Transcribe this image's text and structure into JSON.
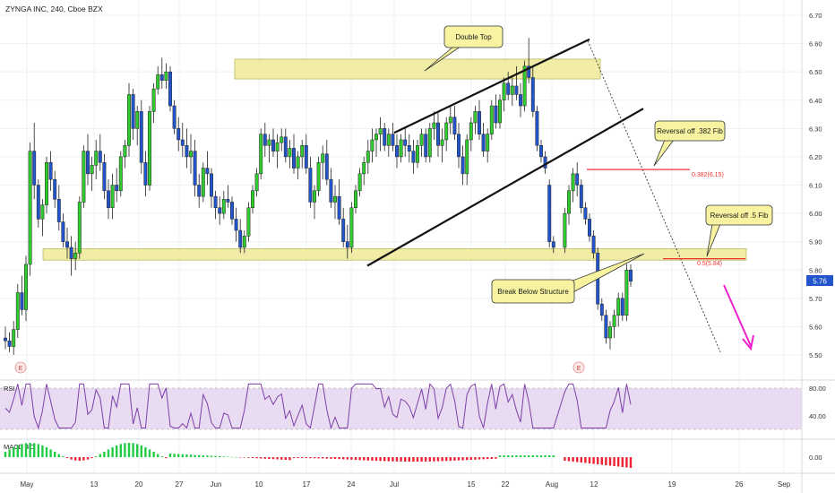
{
  "header": {
    "title": "ZYNGA INC, 240, Cboe BZX"
  },
  "colors": {
    "up": "#2ecc2e",
    "down": "#2255cc",
    "zone": "#f0ec9e",
    "zone_border": "#b7b14a",
    "fib_line": "#ee3333",
    "arrow": "#ee22cc",
    "rsi_line": "#7e3fa8",
    "rsi_band": "#e6d7f1",
    "macd_up": "#22cc44",
    "macd_down": "#ee2233",
    "price_badge": "#2255cc"
  },
  "price_axis": {
    "ticks": [
      "6.70",
      "6.60",
      "6.50",
      "6.40",
      "6.30",
      "6.20",
      "6.10",
      "6.00",
      "5.90",
      "5.80",
      "5.70",
      "5.60",
      "5.50"
    ]
  },
  "last_price": "5.76",
  "rsi": {
    "label": "RSI",
    "ticks": [
      "80.00",
      "40.00"
    ]
  },
  "macd": {
    "label": "MACD 4C",
    "ticks": [
      "0.00"
    ]
  },
  "time_axis": {
    "ticks": [
      "May",
      "13",
      "20",
      "27",
      "Jun",
      "10",
      "17",
      "24",
      "Jul",
      "15",
      "22",
      "Aug",
      "12",
      "19",
      "26",
      "Sep"
    ]
  },
  "annotations": {
    "double_top": "Double Top",
    "reversal_382": "Reversal off .382 Fib",
    "reversal_5": "Reversal off .5 Fib",
    "break_below": "Break Below Structure",
    "fib_382": "0.382(6.15)",
    "fib_5": "0.5(5.84)",
    "earnings_1": "E",
    "earnings_2": "E"
  },
  "chart_data": {
    "type": "candlestick",
    "title": "ZYNGA INC, 240, Cboe BZX",
    "y_range": [
      5.45,
      6.73
    ],
    "candles": [
      [
        "May 1",
        5.56,
        5.6,
        5.52,
        5.55
      ],
      [
        "May 1",
        5.55,
        5.58,
        5.51,
        5.53
      ],
      [
        "May 2",
        5.53,
        5.62,
        5.5,
        5.59
      ],
      [
        "May 2",
        5.59,
        5.75,
        5.56,
        5.72
      ],
      [
        "May 3",
        5.72,
        5.78,
        5.64,
        5.66
      ],
      [
        "May 3",
        5.66,
        5.85,
        5.62,
        5.82
      ],
      [
        "May 6",
        5.82,
        6.25,
        5.78,
        6.22
      ],
      [
        "May 6",
        6.22,
        6.32,
        6.05,
        6.1
      ],
      [
        "May 7",
        6.1,
        6.12,
        5.95,
        5.98
      ],
      [
        "May 7",
        5.98,
        6.05,
        5.92,
        6.03
      ],
      [
        "May 8",
        6.03,
        6.2,
        6.0,
        6.18
      ],
      [
        "May 8",
        6.18,
        6.22,
        6.08,
        6.12
      ],
      [
        "May 9",
        6.12,
        6.15,
        6.02,
        6.05
      ],
      [
        "May 9",
        6.05,
        6.1,
        5.94,
        5.97
      ],
      [
        "May 10",
        5.97,
        6.0,
        5.88,
        5.9
      ],
      [
        "May 10",
        5.9,
        5.95,
        5.84,
        5.88
      ],
      [
        "May 13",
        5.88,
        5.92,
        5.78,
        5.84
      ],
      [
        "May 13",
        5.84,
        5.9,
        5.8,
        5.86
      ],
      [
        "May 14",
        5.86,
        6.06,
        5.84,
        6.04
      ],
      [
        "May 14",
        6.04,
        6.24,
        6.02,
        6.22
      ],
      [
        "May 15",
        6.22,
        6.28,
        6.1,
        6.14
      ],
      [
        "May 15",
        6.14,
        6.2,
        6.08,
        6.17
      ],
      [
        "May 16",
        6.17,
        6.26,
        6.12,
        6.22
      ],
      [
        "May 16",
        6.22,
        6.28,
        6.15,
        6.18
      ],
      [
        "May 17",
        6.18,
        6.21,
        6.05,
        6.08
      ],
      [
        "May 17",
        6.08,
        6.12,
        5.98,
        6.02
      ],
      [
        "May 20",
        6.02,
        6.14,
        5.98,
        6.1
      ],
      [
        "May 20",
        6.1,
        6.16,
        6.04,
        6.08
      ],
      [
        "May 21",
        6.08,
        6.22,
        6.06,
        6.2
      ],
      [
        "May 21",
        6.2,
        6.26,
        6.16,
        6.24
      ],
      [
        "May 22",
        6.24,
        6.46,
        6.2,
        6.42
      ],
      [
        "May 22",
        6.42,
        6.44,
        6.26,
        6.3
      ],
      [
        "May 23",
        6.3,
        6.38,
        6.24,
        6.36
      ],
      [
        "May 23",
        6.36,
        6.4,
        6.14,
        6.18
      ],
      [
        "May 24",
        6.18,
        6.22,
        6.06,
        6.1
      ],
      [
        "May 24",
        6.1,
        6.38,
        6.08,
        6.36
      ],
      [
        "May 28",
        6.36,
        6.46,
        6.32,
        6.44
      ],
      [
        "May 28",
        6.44,
        6.52,
        6.42,
        6.49
      ],
      [
        "May 29",
        6.49,
        6.55,
        6.44,
        6.47
      ],
      [
        "May 29",
        6.47,
        6.53,
        6.44,
        6.5
      ],
      [
        "May 30",
        6.5,
        6.52,
        6.36,
        6.38
      ],
      [
        "May 30",
        6.38,
        6.4,
        6.28,
        6.3
      ],
      [
        "May 31",
        6.3,
        6.34,
        6.22,
        6.26
      ],
      [
        "May 31",
        6.26,
        6.32,
        6.2,
        6.24
      ],
      [
        "Jun 3",
        6.24,
        6.3,
        6.16,
        6.2
      ],
      [
        "Jun 3",
        6.2,
        6.28,
        6.14,
        6.22
      ],
      [
        "Jun 4",
        6.22,
        6.26,
        6.06,
        6.1
      ],
      [
        "Jun 4",
        6.1,
        6.14,
        6.02,
        6.06
      ],
      [
        "Jun 5",
        6.06,
        6.18,
        6.04,
        6.16
      ],
      [
        "Jun 5",
        6.16,
        6.22,
        6.1,
        6.14
      ],
      [
        "Jun 6",
        6.14,
        6.16,
        6.02,
        6.06
      ],
      [
        "Jun 6",
        6.06,
        6.08,
        5.98,
        6.02
      ],
      [
        "Jun 7",
        6.02,
        6.06,
        5.96,
        6.0
      ],
      [
        "Jun 7",
        6.0,
        6.08,
        5.98,
        6.05
      ],
      [
        "Jun 10",
        6.05,
        6.1,
        6.02,
        6.04
      ],
      [
        "Jun 10",
        6.04,
        6.06,
        5.96,
        5.98
      ],
      [
        "Jun 11",
        5.98,
        6.02,
        5.9,
        5.94
      ],
      [
        "Jun 11",
        5.94,
        5.98,
        5.86,
        5.88
      ],
      [
        "Jun 12",
        5.88,
        5.94,
        5.86,
        5.92
      ],
      [
        "Jun 12",
        5.92,
        6.04,
        5.9,
        6.02
      ],
      [
        "Jun 13",
        6.02,
        6.1,
        6.0,
        6.08
      ],
      [
        "Jun 13",
        6.08,
        6.16,
        6.06,
        6.14
      ],
      [
        "Jun 14",
        6.14,
        6.3,
        6.12,
        6.28
      ],
      [
        "Jun 14",
        6.28,
        6.32,
        6.2,
        6.24
      ],
      [
        "Jun 17",
        6.24,
        6.28,
        6.18,
        6.26
      ],
      [
        "Jun 17",
        6.26,
        6.3,
        6.2,
        6.22
      ],
      [
        "Jun 18",
        6.22,
        6.28,
        6.16,
        6.25
      ],
      [
        "Jun 18",
        6.25,
        6.3,
        6.22,
        6.27
      ],
      [
        "Jun 19",
        6.27,
        6.3,
        6.18,
        6.2
      ],
      [
        "Jun 19",
        6.2,
        6.26,
        6.16,
        6.23
      ],
      [
        "Jun 20",
        6.23,
        6.28,
        6.14,
        6.16
      ],
      [
        "Jun 20",
        6.16,
        6.22,
        6.12,
        6.2
      ],
      [
        "Jun 21",
        6.2,
        6.26,
        6.16,
        6.24
      ],
      [
        "Jun 21",
        6.24,
        6.28,
        6.14,
        6.16
      ],
      [
        "Jun 24",
        6.16,
        6.2,
        6.02,
        6.04
      ],
      [
        "Jun 24",
        6.04,
        6.1,
        5.98,
        6.08
      ],
      [
        "Jun 25",
        6.08,
        6.2,
        6.06,
        6.18
      ],
      [
        "Jun 25",
        6.18,
        6.24,
        6.12,
        6.21
      ],
      [
        "Jun 26",
        6.21,
        6.26,
        6.1,
        6.12
      ],
      [
        "Jun 26",
        6.12,
        6.16,
        6.02,
        6.04
      ],
      [
        "Jun 27",
        6.04,
        6.1,
        5.98,
        6.06
      ],
      [
        "Jun 27",
        6.06,
        6.12,
        5.96,
        5.98
      ],
      [
        "Jun 28",
        5.98,
        6.02,
        5.88,
        5.9
      ],
      [
        "Jun 28",
        5.9,
        5.96,
        5.84,
        5.88
      ],
      [
        "Jul 1",
        5.88,
        6.04,
        5.86,
        6.02
      ],
      [
        "Jul 1",
        6.02,
        6.1,
        6.0,
        6.08
      ],
      [
        "Jul 2",
        6.08,
        6.16,
        6.06,
        6.14
      ],
      [
        "Jul 2",
        6.14,
        6.2,
        6.1,
        6.18
      ],
      [
        "Jul 3",
        6.18,
        6.26,
        6.14,
        6.22
      ],
      [
        "Jul 3",
        6.22,
        6.3,
        6.18,
        6.26
      ],
      [
        "Jul 5",
        6.26,
        6.3,
        6.2,
        6.28
      ],
      [
        "Jul 5",
        6.28,
        6.34,
        6.22,
        6.3
      ],
      [
        "Jul 8",
        6.3,
        6.32,
        6.22,
        6.24
      ],
      [
        "Jul 8",
        6.24,
        6.3,
        6.2,
        6.28
      ],
      [
        "Jul 9",
        6.28,
        6.32,
        6.22,
        6.24
      ],
      [
        "Jul 9",
        6.24,
        6.28,
        6.16,
        6.2
      ],
      [
        "Jul 10",
        6.2,
        6.28,
        6.18,
        6.26
      ],
      [
        "Jul 10",
        6.26,
        6.3,
        6.2,
        6.24
      ],
      [
        "Jul 11",
        6.24,
        6.28,
        6.18,
        6.22
      ],
      [
        "Jul 11",
        6.22,
        6.26,
        6.14,
        6.18
      ],
      [
        "Jul 12",
        6.18,
        6.26,
        6.16,
        6.24
      ],
      [
        "Jul 12",
        6.24,
        6.3,
        6.2,
        6.28
      ],
      [
        "Jul 15",
        6.28,
        6.3,
        6.18,
        6.2
      ],
      [
        "Jul 15",
        6.2,
        6.32,
        6.18,
        6.3
      ],
      [
        "Jul 16",
        6.3,
        6.36,
        6.26,
        6.32
      ],
      [
        "Jul 16",
        6.32,
        6.36,
        6.2,
        6.24
      ],
      [
        "Jul 17",
        6.24,
        6.3,
        6.18,
        6.26
      ],
      [
        "Jul 17",
        6.26,
        6.34,
        6.22,
        6.32
      ],
      [
        "Jul 18",
        6.32,
        6.38,
        6.28,
        6.34
      ],
      [
        "Jul 18",
        6.34,
        6.38,
        6.26,
        6.28
      ],
      [
        "Jul 19",
        6.28,
        6.32,
        6.16,
        6.2
      ],
      [
        "Jul 19",
        6.2,
        6.24,
        6.1,
        6.14
      ],
      [
        "Jul 22",
        6.14,
        6.28,
        6.1,
        6.26
      ],
      [
        "Jul 22",
        6.26,
        6.34,
        6.22,
        6.32
      ],
      [
        "Jul 23",
        6.32,
        6.38,
        6.28,
        6.36
      ],
      [
        "Jul 23",
        6.36,
        6.4,
        6.26,
        6.28
      ],
      [
        "Jul 24",
        6.28,
        6.32,
        6.2,
        6.22
      ],
      [
        "Jul 24",
        6.22,
        6.3,
        6.18,
        6.28
      ],
      [
        "Jul 25",
        6.28,
        6.4,
        6.26,
        6.38
      ],
      [
        "Jul 25",
        6.38,
        6.42,
        6.3,
        6.32
      ],
      [
        "Jul 26",
        6.32,
        6.42,
        6.3,
        6.4
      ],
      [
        "Jul 26",
        6.4,
        6.48,
        6.36,
        6.46
      ],
      [
        "Jul 29",
        6.46,
        6.5,
        6.4,
        6.42
      ],
      [
        "Jul 29",
        6.42,
        6.48,
        6.38,
        6.45
      ],
      [
        "Jul 30",
        6.45,
        6.52,
        6.4,
        6.42
      ],
      [
        "Jul 30",
        6.42,
        6.46,
        6.34,
        6.38
      ],
      [
        "Jul 31",
        6.38,
        6.54,
        6.36,
        6.52
      ],
      [
        "Jul 31",
        6.52,
        6.62,
        6.46,
        6.48
      ],
      [
        "Aug 1",
        6.48,
        6.52,
        6.34,
        6.36
      ],
      [
        "Aug 1",
        6.36,
        6.38,
        6.22,
        6.24
      ],
      [
        "Aug 2",
        6.24,
        6.26,
        6.18,
        6.2
      ],
      [
        "Aug 2",
        6.2,
        6.22,
        6.14,
        6.16
      ],
      [
        "Aug 5",
        6.1,
        6.12,
        5.88,
        5.9
      ],
      [
        "Aug 5",
        5.9,
        5.92,
        5.86,
        5.88
      ],
      [
        "Aug 6",
        5.88,
        6.02,
        5.86,
        6.0
      ],
      [
        "Aug 6",
        6.0,
        6.1,
        5.96,
        6.08
      ],
      [
        "Aug 7",
        6.08,
        6.16,
        6.04,
        6.14
      ],
      [
        "Aug 7",
        6.14,
        6.18,
        6.06,
        6.1
      ],
      [
        "Aug 8",
        6.1,
        6.12,
        6.0,
        6.02
      ],
      [
        "Aug 8",
        6.02,
        6.04,
        5.96,
        5.98
      ],
      [
        "Aug 9",
        5.98,
        6.0,
        5.9,
        5.92
      ],
      [
        "Aug 9",
        5.92,
        5.94,
        5.84,
        5.86
      ],
      [
        "Aug 12",
        5.86,
        5.88,
        5.66,
        5.68
      ],
      [
        "Aug 12",
        5.68,
        5.7,
        5.62,
        5.64
      ],
      [
        "Aug 13",
        5.64,
        5.66,
        5.54,
        5.56
      ],
      [
        "Aug 13",
        5.56,
        5.62,
        5.52,
        5.6
      ],
      [
        "Aug 14",
        5.6,
        5.66,
        5.56,
        5.64
      ],
      [
        "Aug 14",
        5.64,
        5.72,
        5.6,
        5.7
      ],
      [
        "Aug 15",
        5.7,
        5.72,
        5.62,
        5.64
      ],
      [
        "Aug 15",
        5.64,
        5.82,
        5.62,
        5.8
      ],
      [
        "Aug 16",
        5.8,
        5.82,
        5.74,
        5.76
      ]
    ]
  }
}
